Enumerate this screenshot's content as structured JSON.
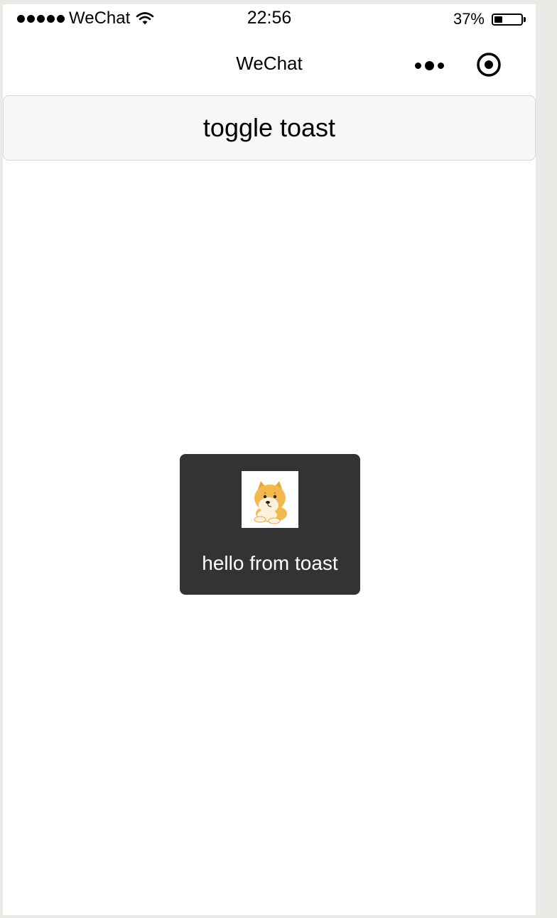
{
  "status_bar": {
    "carrier": "WeChat",
    "time": "22:56",
    "battery_percent": "37%",
    "battery_level": 0.37,
    "signal_dots": 5,
    "icons": [
      "signal-dots-icon",
      "wifi-icon",
      "battery-icon"
    ]
  },
  "navbar": {
    "title": "WeChat",
    "icons": [
      "more-icon",
      "close-target-icon"
    ]
  },
  "main": {
    "toggle_button_label": "toggle toast"
  },
  "toast": {
    "text": "hello from toast",
    "image_icon": "doge-icon"
  },
  "colors": {
    "toast_background": "#333333",
    "button_background": "#f7f7f7",
    "page_background": "#ffffff"
  }
}
